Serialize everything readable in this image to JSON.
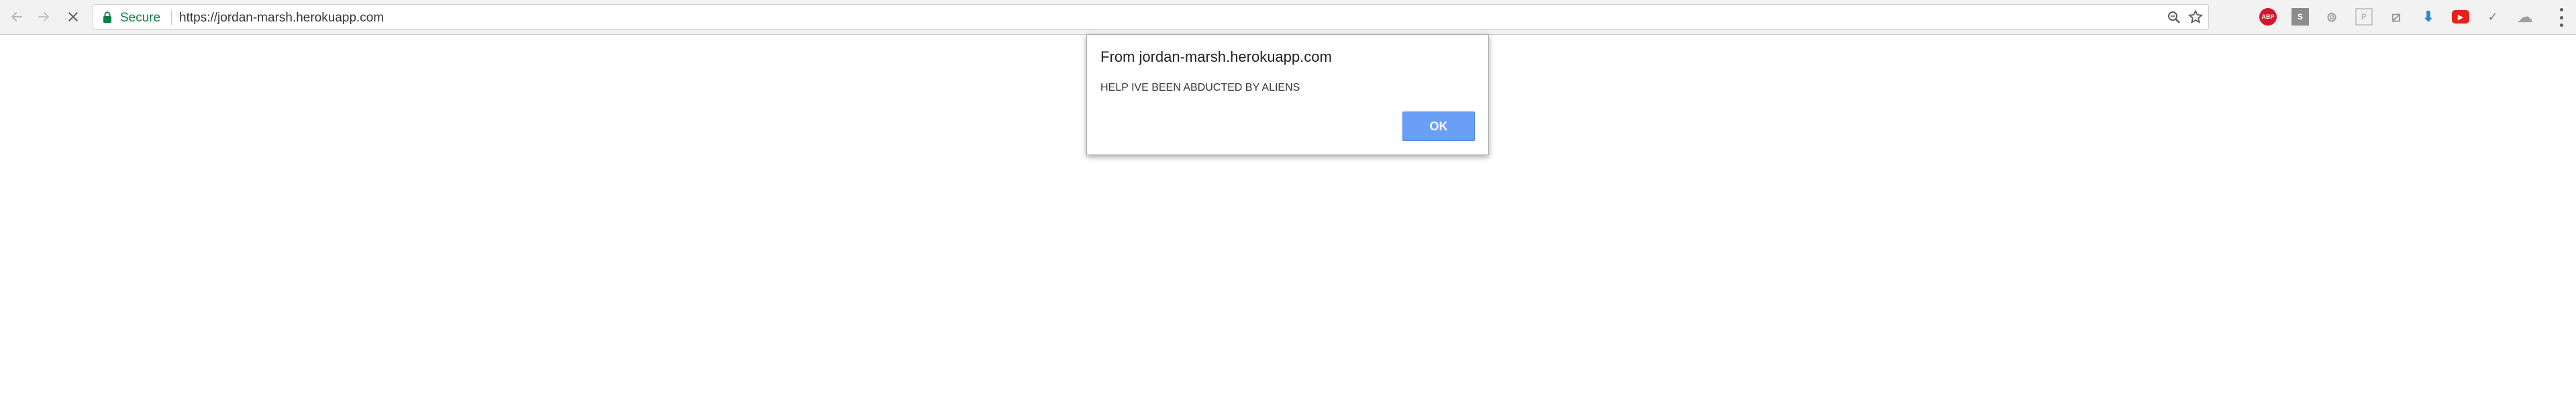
{
  "browser": {
    "secure_label": "Secure",
    "url": "https://jordan-marsh.herokuapp.com",
    "icons": {
      "back": "back-arrow-icon",
      "forward": "forward-arrow-icon",
      "stop": "stop-loading-icon",
      "lock": "lock-icon",
      "zoom": "zoom-icon",
      "bookmark": "star-icon",
      "menu": "more-vert-icon"
    },
    "extensions": [
      {
        "name": "adblock-plus-icon",
        "glyph": "ABP",
        "color": "#d3172e"
      },
      {
        "name": "extension-s-icon",
        "glyph": "S",
        "color": "#808080"
      },
      {
        "name": "extension-circle-icon",
        "glyph": "⊚",
        "color": "#9a9a9a"
      },
      {
        "name": "extension-p-icon",
        "glyph": "P",
        "color": "#b8b8b8"
      },
      {
        "name": "extension-box-icon",
        "glyph": "⧄",
        "color": "#9a9a9a"
      },
      {
        "name": "download-icon",
        "glyph": "⬇",
        "color": "#1e88e5"
      },
      {
        "name": "youtube-icon",
        "glyph": "▶",
        "color": "#e62117"
      },
      {
        "name": "check-icon",
        "glyph": "✓",
        "color": "#7a7a7a"
      },
      {
        "name": "cloud-icon",
        "glyph": "☁",
        "color": "#9a9a9a"
      }
    ],
    "secure_color": "#0b8043"
  },
  "dialog": {
    "title": "From jordan-marsh.herokuapp.com",
    "message": "HELP IVE BEEN ABDUCTED BY ALIENS",
    "ok_label": "OK",
    "ok_color": "#6a9ff7"
  }
}
